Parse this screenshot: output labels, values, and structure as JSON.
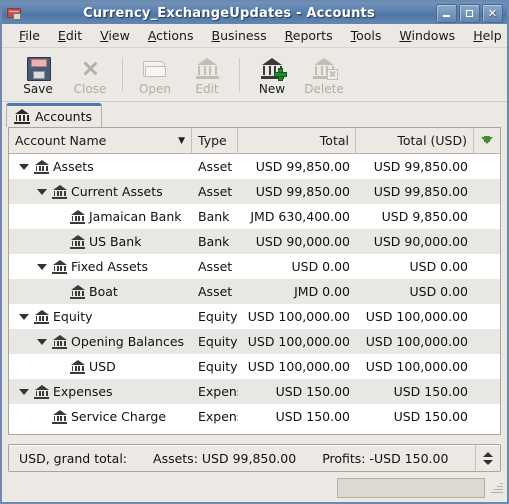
{
  "window": {
    "title": "Currency_ExchangeUpdates - Accounts",
    "app_icon": "credit-card-icon",
    "controls": {
      "minimize": "minimize-icon",
      "maximize": "maximize-icon",
      "close": "close-icon"
    }
  },
  "menubar": {
    "items": [
      {
        "label": "File",
        "mnemonic": "F"
      },
      {
        "label": "Edit",
        "mnemonic": "E"
      },
      {
        "label": "View",
        "mnemonic": "V"
      },
      {
        "label": "Actions",
        "mnemonic": "A"
      },
      {
        "label": "Business",
        "mnemonic": "B"
      },
      {
        "label": "Reports",
        "mnemonic": "R"
      },
      {
        "label": "Tools",
        "mnemonic": "T"
      },
      {
        "label": "Windows",
        "mnemonic": "W"
      },
      {
        "label": "Help",
        "mnemonic": "H"
      }
    ]
  },
  "toolbar": {
    "buttons": [
      {
        "label": "Save",
        "icon": "floppy-disk-icon",
        "enabled": true
      },
      {
        "label": "Close",
        "icon": "x-close-icon",
        "enabled": false
      },
      {
        "label": "Open",
        "icon": "folder-open-icon",
        "enabled": false
      },
      {
        "label": "Edit",
        "icon": "bank-edit-icon",
        "enabled": false
      },
      {
        "label": "New",
        "icon": "bank-plus-icon",
        "enabled": true
      },
      {
        "label": "Delete",
        "icon": "bank-delete-icon",
        "enabled": false
      }
    ]
  },
  "tabs": [
    {
      "label": "Accounts",
      "icon": "bank-icon",
      "active": true
    }
  ],
  "table": {
    "columns": [
      {
        "key": "name",
        "label": "Account Name",
        "sort_indicator": "chevron-down-icon"
      },
      {
        "key": "type",
        "label": "Type"
      },
      {
        "key": "total",
        "label": "Total"
      },
      {
        "key": "totalusd",
        "label": "Total (USD)"
      }
    ],
    "column_menu_icon": "green-down-arrow-icon",
    "rows": [
      {
        "name": "Assets",
        "depth": 0,
        "expandable": true,
        "expanded": true,
        "type": "Asset",
        "total": "USD 99,850.00",
        "totalusd": "USD 99,850.00"
      },
      {
        "name": "Current Assets",
        "depth": 1,
        "expandable": true,
        "expanded": true,
        "type": "Asset",
        "total": "USD 99,850.00",
        "totalusd": "USD 99,850.00"
      },
      {
        "name": "Jamaican Bank",
        "depth": 2,
        "expandable": false,
        "expanded": false,
        "type": "Bank",
        "total": "JMD 630,400.00",
        "totalusd": "USD 9,850.00"
      },
      {
        "name": "US Bank",
        "depth": 2,
        "expandable": false,
        "expanded": false,
        "type": "Bank",
        "total": "USD 90,000.00",
        "totalusd": "USD 90,000.00"
      },
      {
        "name": "Fixed Assets",
        "depth": 1,
        "expandable": true,
        "expanded": true,
        "type": "Asset",
        "total": "USD 0.00",
        "totalusd": "USD 0.00"
      },
      {
        "name": "Boat",
        "depth": 2,
        "expandable": false,
        "expanded": false,
        "type": "Asset",
        "total": "JMD 0.00",
        "totalusd": "USD 0.00"
      },
      {
        "name": "Equity",
        "depth": 0,
        "expandable": true,
        "expanded": true,
        "type": "Equity",
        "total": "USD 100,000.00",
        "totalusd": "USD 100,000.00"
      },
      {
        "name": "Opening Balances",
        "depth": 1,
        "expandable": true,
        "expanded": true,
        "type": "Equity",
        "total": "USD 100,000.00",
        "totalusd": "USD 100,000.00"
      },
      {
        "name": "USD",
        "depth": 2,
        "expandable": false,
        "expanded": false,
        "type": "Equity",
        "total": "USD 100,000.00",
        "totalusd": "USD 100,000.00"
      },
      {
        "name": "Expenses",
        "depth": 0,
        "expandable": true,
        "expanded": true,
        "type": "Expens",
        "total": "USD 150.00",
        "totalusd": "USD 150.00"
      },
      {
        "name": "Service Charge",
        "depth": 1,
        "expandable": false,
        "expanded": false,
        "type": "Expens",
        "total": "USD 150.00",
        "totalusd": "USD 150.00"
      }
    ]
  },
  "summary": {
    "label": "USD, grand total:",
    "assets": "Assets: USD 99,850.00",
    "profits": "Profits: -USD 150.00",
    "spinner_icon": "up-down-spinner-icon"
  },
  "statusbar": {
    "panel_text": "",
    "resize_grip": "resize-grip-icon"
  },
  "colors": {
    "titlebar": "#5b80ad",
    "tab_accent": "#4b79b5",
    "row_even": "#e8e7e4",
    "row_odd": "#ffffff",
    "chrome": "#ece9e4",
    "green_arrow": "#4a8a3c"
  }
}
